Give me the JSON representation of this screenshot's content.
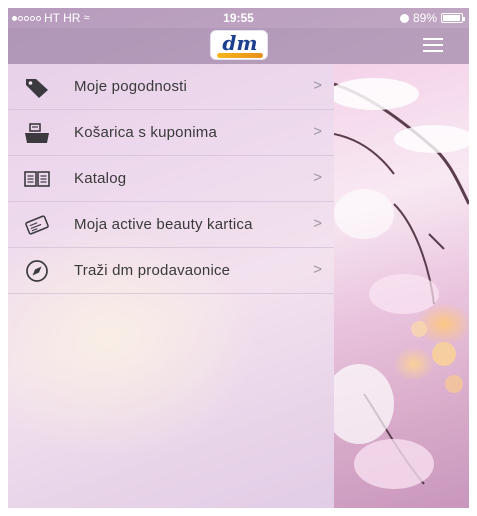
{
  "status_bar": {
    "carrier": "HT HR",
    "time": "19:55",
    "battery": "89%",
    "battery_level": 0.89,
    "signal_bars_filled": 1,
    "signal_bars_total": 5
  },
  "header": {
    "logo_text": "dm",
    "logo_colors": {
      "text": "#1b3f8e",
      "swoosh": "#f7b51d"
    },
    "menu_icon": "hamburger-icon"
  },
  "menu": {
    "items": [
      {
        "label": "Moje pogodnosti",
        "icon": "tag-icon",
        "chevron": ">"
      },
      {
        "label": "Košarica s kuponima",
        "icon": "cart-icon",
        "chevron": ">"
      },
      {
        "label": "Katalog",
        "icon": "catalog-icon",
        "chevron": ">"
      },
      {
        "label": "Moja active beauty kartica",
        "icon": "card-icon",
        "chevron": ">"
      },
      {
        "label": "Traži dm prodavaonice",
        "icon": "compass-icon",
        "chevron": ">"
      }
    ]
  }
}
